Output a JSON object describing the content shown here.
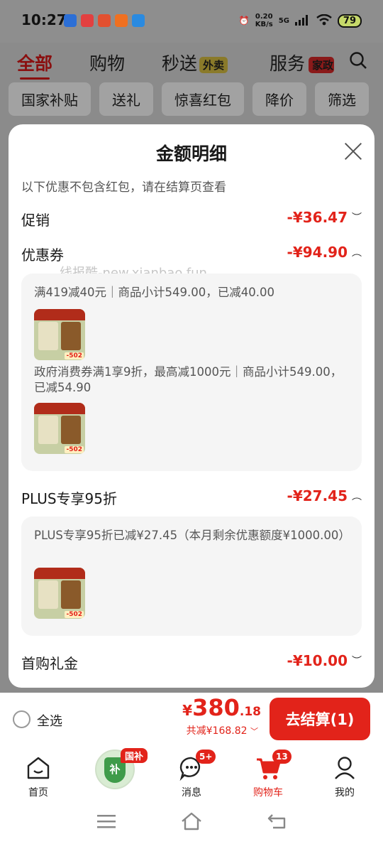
{
  "status": {
    "time": "10:27",
    "net_speed": "0.20",
    "net_unit": "KB/s",
    "signal": "5G",
    "battery": "79"
  },
  "top_nav": {
    "tabs": [
      "全部",
      "购物",
      "秒送",
      "服务"
    ],
    "badge_waimai": "外卖",
    "badge_jiazheng": "家政"
  },
  "chips": [
    "国家补贴",
    "送礼",
    "惊喜红包",
    "降价",
    "筛选"
  ],
  "sheet": {
    "title": "金额明细",
    "notice": "以下优惠不包含红包，请在结算页查看",
    "watermark": "线报酷-new.xianbao.fun",
    "rows": {
      "promo": {
        "label": "促销",
        "amount": "-¥36.47"
      },
      "coupon": {
        "label": "优惠券",
        "amount": "-¥94.90"
      },
      "plus": {
        "label": "PLUS专享95折",
        "amount": "-¥27.45"
      },
      "first": {
        "label": "首购礼金",
        "amount": "-¥10.00"
      }
    },
    "coupon_details": [
      {
        "text": "满419减40元｜商品小计549.00，已减40.00",
        "thumb_tag": "-502"
      },
      {
        "text": "政府消费券满1享9折，最高减1000元｜商品小计549.00，已减54.90",
        "thumb_tag": "-502"
      }
    ],
    "plus_detail": {
      "text": "PLUS专享95折已减¥27.45（本月剩余优惠额度¥1000.00）",
      "thumb_tag": "-502"
    }
  },
  "checkout": {
    "select_all": "全选",
    "currency": "¥",
    "total_int": "380",
    "total_dec": ".18",
    "saved": "共减¥168.82",
    "button": "去结算(1)"
  },
  "tabbar": {
    "home": "首页",
    "gov_badge": "国补",
    "gov_icon_text": "补",
    "messages": "消息",
    "messages_count": "5+",
    "cart": "购物车",
    "cart_count": "13",
    "mine": "我的"
  },
  "colors": {
    "accent": "#e2231a",
    "panel": "#f5f5f5"
  }
}
